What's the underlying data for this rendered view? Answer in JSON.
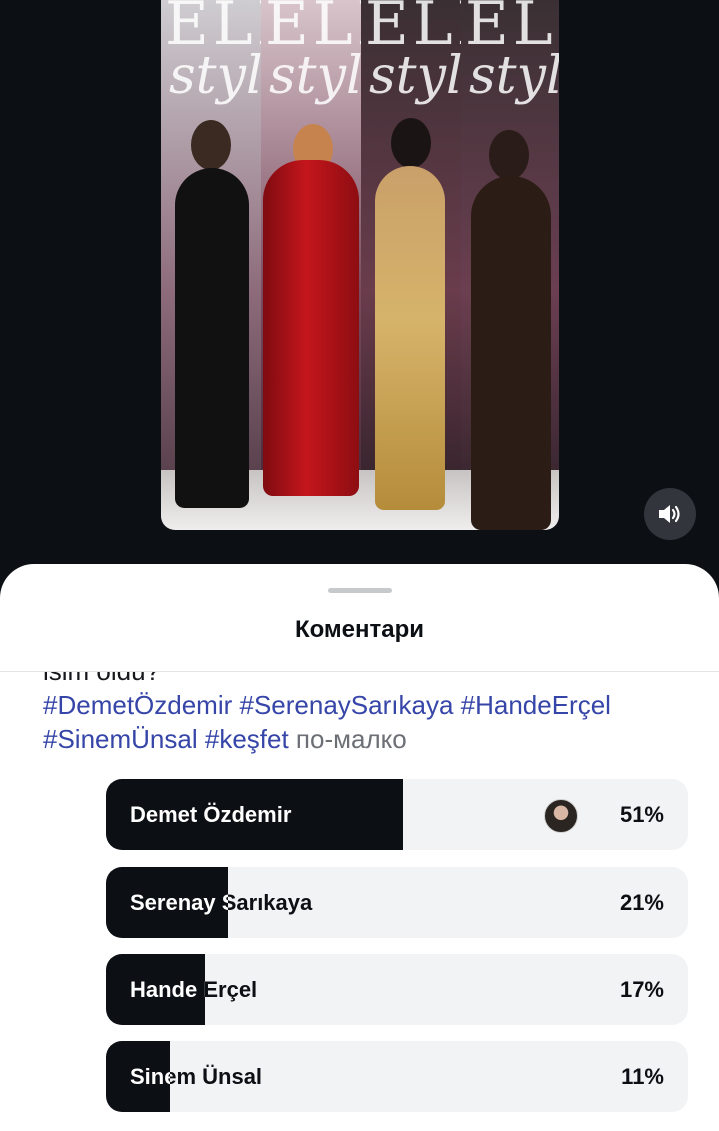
{
  "media": {
    "panels": [
      {
        "logo": "ELLE",
        "script": "style",
        "outfit_color": "#111111"
      },
      {
        "logo": "ELLE",
        "script": "style",
        "outfit_color": "#b0161b"
      },
      {
        "logo": "ELLE",
        "script": "style",
        "outfit_color": "#c9a14e"
      },
      {
        "logo": "ELLE",
        "script": "style",
        "outfit_color": "#2b1d16"
      }
    ],
    "sound_icon": "speaker-icon"
  },
  "comments": {
    "title": "Коментари",
    "caption_cut": "isim oldu?",
    "hashtags_line1": "#DemetÖzdemir #SerenaySarıkaya #HandeErçel",
    "hashtags_line2": "#SinemÜnsal #keşfet",
    "more_label": "по-малко"
  },
  "poll": {
    "fill_color": "#0c0f14",
    "options": [
      {
        "label": "Demet Özdemir",
        "percent_label": "51%",
        "fraction": 0.51
      },
      {
        "label": "Serenay Sarıkaya",
        "percent_label": "21%",
        "fraction": 0.21
      },
      {
        "label": "Hande Erçel",
        "percent_label": "17%",
        "fraction": 0.17
      },
      {
        "label": "Sinem Ünsal",
        "percent_label": "11%",
        "fraction": 0.11
      }
    ]
  }
}
